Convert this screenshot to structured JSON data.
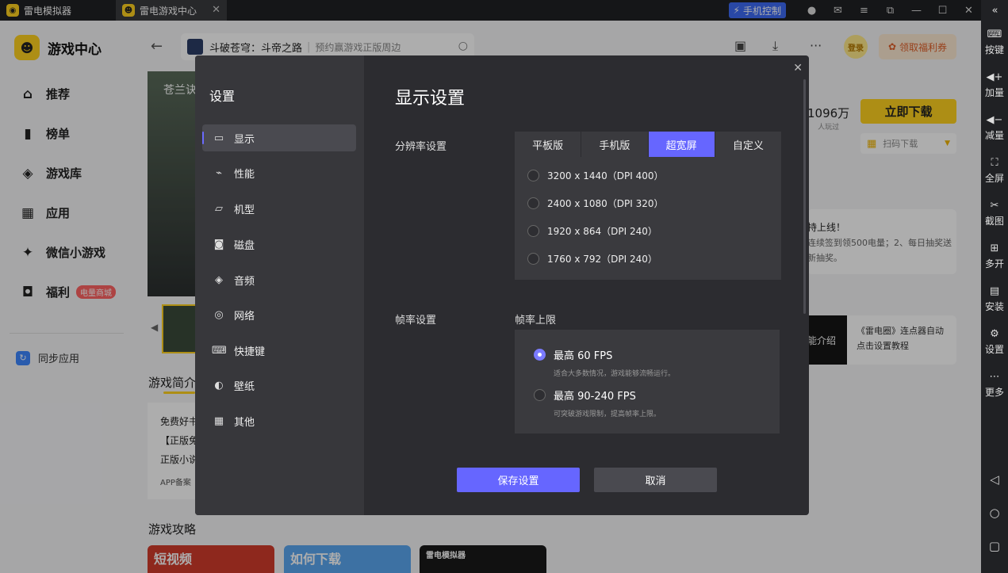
{
  "titlebar": {
    "tab1": "雷电模拟器",
    "tab2": "雷电游戏中心",
    "phone_control": "手机控制"
  },
  "right_bar": {
    "items": [
      {
        "label": "按键",
        "icon": "keyboard-icon"
      },
      {
        "label": "加量",
        "icon": "volume-up-icon"
      },
      {
        "label": "减量",
        "icon": "volume-down-icon"
      },
      {
        "label": "全屏",
        "icon": "fullscreen-icon"
      },
      {
        "label": "截图",
        "icon": "scissors-icon"
      },
      {
        "label": "多开",
        "icon": "multi-instance-icon"
      },
      {
        "label": "安装",
        "icon": "apk-icon"
      },
      {
        "label": "设置",
        "icon": "gear-icon"
      },
      {
        "label": "更多",
        "icon": "more-icon"
      }
    ]
  },
  "leftnav": {
    "app_title": "游戏中心",
    "items": [
      {
        "label": "推荐",
        "icon": "home-icon"
      },
      {
        "label": "榜单",
        "icon": "chart-icon"
      },
      {
        "label": "游戏库",
        "icon": "gamepad-icon"
      },
      {
        "label": "应用",
        "icon": "apps-icon"
      },
      {
        "label": "微信小游戏",
        "icon": "star-icon"
      },
      {
        "label": "福利",
        "icon": "gift-icon"
      }
    ],
    "welfare_badge": "电量商城",
    "sync_label": "同步应用"
  },
  "header": {
    "search_game": "斗破苍穹：斗帝之路",
    "search_hint": "预约赢游戏正版周边",
    "login": "登录",
    "coupon": "领取福利券"
  },
  "background": {
    "banner_text": "苍兰诀",
    "intro_title": "游戏简介",
    "intro_lines": [
      "免费好书",
      "【正版免",
      "正版小说",
      "APP备案"
    ],
    "guide_title": "游戏攻略",
    "guide_cards": [
      "短视频",
      "如何下载",
      "雷电模拟器"
    ],
    "download_count": "1096万",
    "download_count_label": "人玩过",
    "download_btn": "立即下载",
    "scan_label": "扫码下载",
    "notice_title": "持上线！",
    "notice_lines": [
      "连续签到领500电量；2、每日抽奖送",
      "新抽奖。"
    ],
    "video_thumb": "能介绍",
    "video_title_1": "《雷电圈》连点器自动",
    "video_title_2": "点击设置教程"
  },
  "modal": {
    "sidebar_title": "设置",
    "menu": [
      {
        "label": "显示",
        "icon": "monitor-icon"
      },
      {
        "label": "性能",
        "icon": "performance-icon"
      },
      {
        "label": "机型",
        "icon": "folder-icon"
      },
      {
        "label": "磁盘",
        "icon": "disk-icon"
      },
      {
        "label": "音频",
        "icon": "gamepad-icon"
      },
      {
        "label": "网络",
        "icon": "globe-icon"
      },
      {
        "label": "快捷键",
        "icon": "keyboard-icon"
      },
      {
        "label": "壁纸",
        "icon": "palette-icon"
      },
      {
        "label": "其他",
        "icon": "grid-icon"
      }
    ],
    "title": "显示设置",
    "resolution_label": "分辨率设置",
    "res_tabs": [
      "平板版",
      "手机版",
      "超宽屏",
      "自定义"
    ],
    "res_tab_selected": "超宽屏",
    "res_options": [
      "3200 x 1440（DPI 400）",
      "2400 x 1080（DPI 320）",
      "1920 x 864（DPI 240）",
      "1760 x 792（DPI 240）"
    ],
    "fps_label": "帧率设置",
    "fps_limit_label": "帧率上限",
    "fps_options": [
      {
        "label": "最高 60 FPS",
        "desc": "适合大多数情况，游戏能够流畅运行。",
        "selected": true
      },
      {
        "label": "最高 90-240 FPS",
        "desc": "可突破游戏限制，提高帧率上限。",
        "selected": false
      }
    ],
    "save": "保存设置",
    "cancel": "取消"
  },
  "colors": {
    "accent": "#6666ff",
    "brand": "#ffd21f"
  }
}
